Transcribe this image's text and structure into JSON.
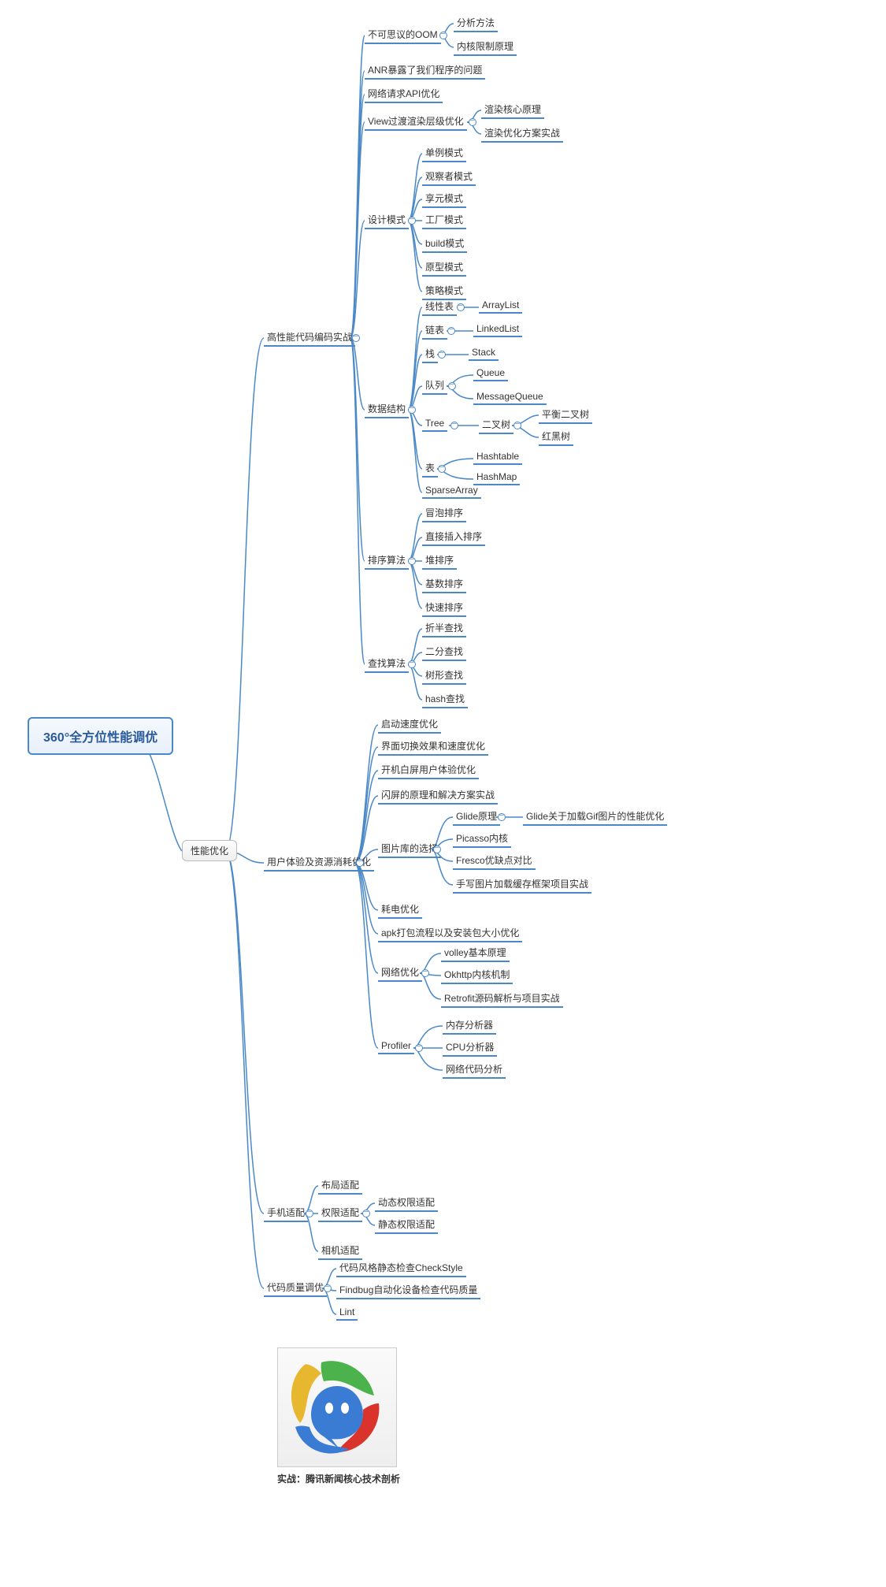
{
  "root": {
    "label": "360°全方位性能调优"
  },
  "hub": {
    "label": "性能优化"
  },
  "caption": "实战：腾讯新闻核心技术剖析",
  "branches": {
    "b1": "高性能代码编码实战",
    "b2": "用户体验及资源消耗优化",
    "b3": "手机适配",
    "b4": "代码质量调优"
  },
  "b1": {
    "n1": "不可思议的OOM",
    "n1a": "分析方法",
    "n1b": "内核限制原理",
    "n2": "ANR暴露了我们程序的问题",
    "n3": "网络请求API优化",
    "n4": "View过渡渲染层级优化",
    "n4a": "渲染核心原理",
    "n4b": "渲染优化方案实战",
    "n5": "设计模式",
    "n5a": "单例模式",
    "n5b": "观察者模式",
    "n5c": "享元模式",
    "n5d": "工厂模式",
    "n5e": "build模式",
    "n5f": "原型模式",
    "n5g": "策略模式",
    "n6": "数据结构",
    "n6a": "线性表",
    "n6a1": "ArrayList",
    "n6b": "链表",
    "n6b1": "LinkedList",
    "n6c": "栈",
    "n6c1": "Stack",
    "n6d": "队列",
    "n6d1": "Queue",
    "n6d2": "MessageQueue",
    "n6e": "Tree",
    "n6e1": "二叉树",
    "n6e1a": "平衡二叉树",
    "n6e1b": "红黑树",
    "n6f": "表",
    "n6f1": "Hashtable",
    "n6f2": "HashMap",
    "n6g": "SparseArray",
    "n7": "排序算法",
    "n7a": "冒泡排序",
    "n7b": "直接插入排序",
    "n7c": "堆排序",
    "n7d": "基数排序",
    "n7e": "快速排序",
    "n8": "查找算法",
    "n8a": "折半查找",
    "n8b": "二分查找",
    "n8c": "树形查找",
    "n8d": "hash查找"
  },
  "b2": {
    "n1": "启动速度优化",
    "n2": "界面切换效果和速度优化",
    "n3": "开机白屏用户体验优化",
    "n4": "闪屏的原理和解决方案实战",
    "n5": "图片库的选择",
    "n5a": "Glide原理",
    "n5a1": "Glide关于加载Gif图片的性能优化",
    "n5b": "Picasso内核",
    "n5c": "Fresco优缺点对比",
    "n5d": "手写图片加载缓存框架项目实战",
    "n6": "耗电优化",
    "n7": "apk打包流程以及安装包大小优化",
    "n8": "网络优化",
    "n8a": "volley基本原理",
    "n8b": "Okhttp内核机制",
    "n8c": "Retrofit源码解析与项目实战",
    "n9": "Profiler",
    "n9a": "内存分析器",
    "n9b": "CPU分析器",
    "n9c": "网络代码分析"
  },
  "b3": {
    "n1": "布局适配",
    "n2": "权限适配",
    "n2a": "动态权限适配",
    "n2b": "静态权限适配",
    "n3": "相机适配"
  },
  "b4": {
    "n1": "代码风格静态检查CheckStyle",
    "n2": "Findbug自动化设备检查代码质量",
    "n3": "Lint"
  }
}
